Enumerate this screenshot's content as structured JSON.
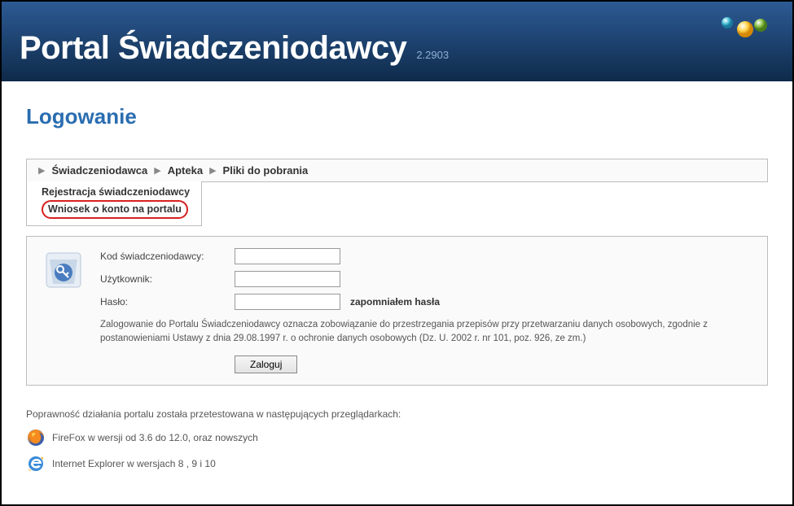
{
  "header": {
    "title": "Portal Świadczeniodawcy",
    "version": "2.2903"
  },
  "page": {
    "heading": "Logowanie"
  },
  "nav": {
    "items": [
      "Świadczeniodawca",
      "Apteka",
      "Pliki do pobrania"
    ]
  },
  "tab": {
    "line1": "Rejestracja świadczeniodawcy",
    "line2": "Wniosek o konto na portalu"
  },
  "form": {
    "code_label": "Kod świadczeniodawcy:",
    "user_label": "Użytkownik:",
    "pass_label": "Hasło:",
    "code_value": "",
    "user_value": "",
    "pass_value": "",
    "forgot_label": "zapomniałem hasła",
    "legal": "Zalogowanie do Portalu Świadczeniodawcy oznacza zobowiązanie do przestrzegania przepisów przy przetwarzaniu danych osobowych, zgodnie z postanowieniami Ustawy z dnia 29.08.1997 r. o ochronie danych osobowych (Dz. U. 2002 r. nr 101, poz. 926, ze zm.)",
    "login_button": "Zaloguj"
  },
  "compat": {
    "intro": "Poprawność działania portalu została przetestowana w następujących przeglądarkach:",
    "firefox": "FireFox w wersji od 3.6 do 12.0, oraz nowszych",
    "ie": "Internet Explorer w wersjach 8 , 9 i 10"
  }
}
